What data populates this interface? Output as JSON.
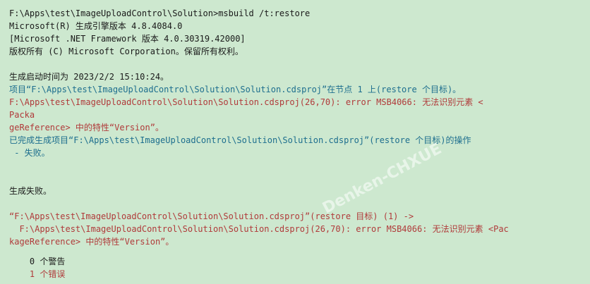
{
  "colors": {
    "background": "#CDE8CF",
    "text": "#1a1a1a",
    "info": "#1D6E8E",
    "error": "#B03A3A"
  },
  "console": {
    "command": "F:\\Apps\\test\\ImageUploadControl\\Solution>msbuild /t:restore",
    "header1": "Microsoft(R) 生成引擎版本 4.8.4084.0",
    "header2": "[Microsoft .NET Framework 版本 4.0.30319.42000]",
    "header3": "版权所有 (C) Microsoft Corporation。保留所有权利。",
    "build_start": "生成启动时间为 2023/2/2 15:10:24。",
    "project_line": "项目“F:\\Apps\\test\\ImageUploadControl\\Solution\\Solution.cdsproj”在节点 1 上(restore 个目标)。",
    "error1_a": "F:\\Apps\\test\\ImageUploadControl\\Solution\\Solution.cdsproj(26,70): error MSB4066: 无法识别元素 <",
    "error1_b": "Packa",
    "error1_c": "geReference> 中的特性“Version”。",
    "done_a": "已完成生成项目“F:\\Apps\\test\\ImageUploadControl\\Solution\\Solution.cdsproj”(restore 个目标)的操作",
    "done_b": " - 失败。",
    "build_failed": "生成失败。",
    "summary_project": "“F:\\Apps\\test\\ImageUploadControl\\Solution\\Solution.cdsproj”(restore 目标) (1) ->",
    "summary_error_a": "  F:\\Apps\\test\\ImageUploadControl\\Solution\\Solution.cdsproj(26,70): error MSB4066: 无法识别元素 <Pac",
    "summary_error_b": "kageReference> 中的特性“Version”。",
    "warnings": "    0 个警告",
    "errors": "    1 个错误"
  },
  "watermark": "Denken-CHXUE"
}
